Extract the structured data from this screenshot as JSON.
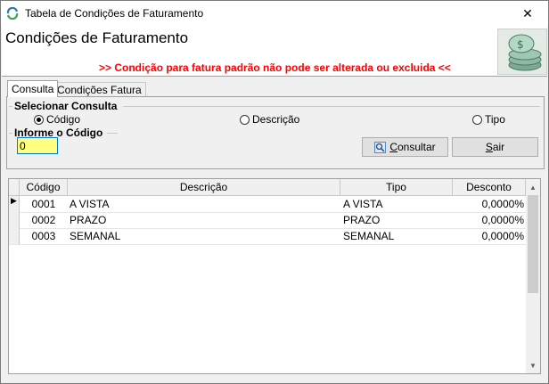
{
  "window": {
    "title": "Tabela de Condições de Faturamento",
    "close_glyph": "✕"
  },
  "header": {
    "title": "Condições de Faturamento",
    "note": ">> Condição para fatura padrão não pode ser alterada ou excluida <<",
    "note_color": "#ff0000"
  },
  "tabs": [
    {
      "label": "Consulta",
      "active": true
    },
    {
      "label": "Condições Fatura",
      "active": false
    }
  ],
  "consulta": {
    "select_label": "Selecionar Consulta",
    "options": [
      {
        "label": "Código",
        "selected": true
      },
      {
        "label": "Descrição",
        "selected": false
      },
      {
        "label": "Tipo",
        "selected": false
      }
    ],
    "input_label": "Informe o Código",
    "input_value": "0",
    "consultar_label": "Consultar",
    "sair_label": "Sair"
  },
  "grid": {
    "columns": [
      "Código",
      "Descrição",
      "Tipo",
      "Desconto"
    ],
    "rows": [
      [
        "0001",
        "A VISTA",
        "A VISTA",
        "0,0000%"
      ],
      [
        "0002",
        "PRAZO",
        "PRAZO",
        "0,0000%"
      ],
      [
        "0003",
        "SEMANAL",
        "SEMANAL",
        "0,0000%"
      ]
    ],
    "current_row": 0,
    "current_row_glyph": "▶"
  },
  "colors": {
    "input_bg": "#ffff80",
    "accent": "#0078d7"
  }
}
